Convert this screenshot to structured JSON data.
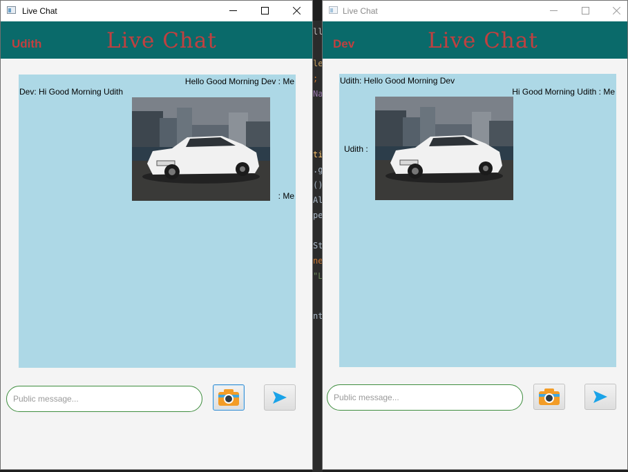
{
  "windows": [
    {
      "title": "Live Chat",
      "user": "Udith",
      "app_title": "Live Chat",
      "messages": [
        {
          "text": "Hello Good Morning Dev : Me",
          "align": "right"
        },
        {
          "text": "Dev: Hi Good Morning Udith",
          "align": "left"
        },
        {
          "text": ": Me",
          "align": "right",
          "caption_of": "image"
        }
      ],
      "input_placeholder": "Public message...",
      "buttons": {
        "camera": "camera-icon",
        "send": "send-icon"
      }
    },
    {
      "title": "Live Chat",
      "user": "Dev",
      "app_title": "Live Chat",
      "messages": [
        {
          "text": "Udith: Hello Good Morning Dev",
          "align": "left"
        },
        {
          "text": "Hi Good Morning Udith : Me",
          "align": "right"
        },
        {
          "text": "Udith :",
          "align": "left",
          "caption_of": "image"
        }
      ],
      "input_placeholder": "Public message...",
      "buttons": {
        "camera": "camera-icon",
        "send": "send-icon"
      }
    }
  ],
  "colors": {
    "header": "#0a6a6a",
    "header_text": "#c04040",
    "chat_background": "#add8e6",
    "input_border": "#3c8c3c",
    "send_accent": "#1aa3e8"
  },
  "ide_fragments": [
    "lle",
    "le",
    ";",
    "Na",
    "ti",
    ".g",
    "()",
    "Al",
    "pe",
    "St",
    "ne",
    "\"L",
    "nt"
  ]
}
